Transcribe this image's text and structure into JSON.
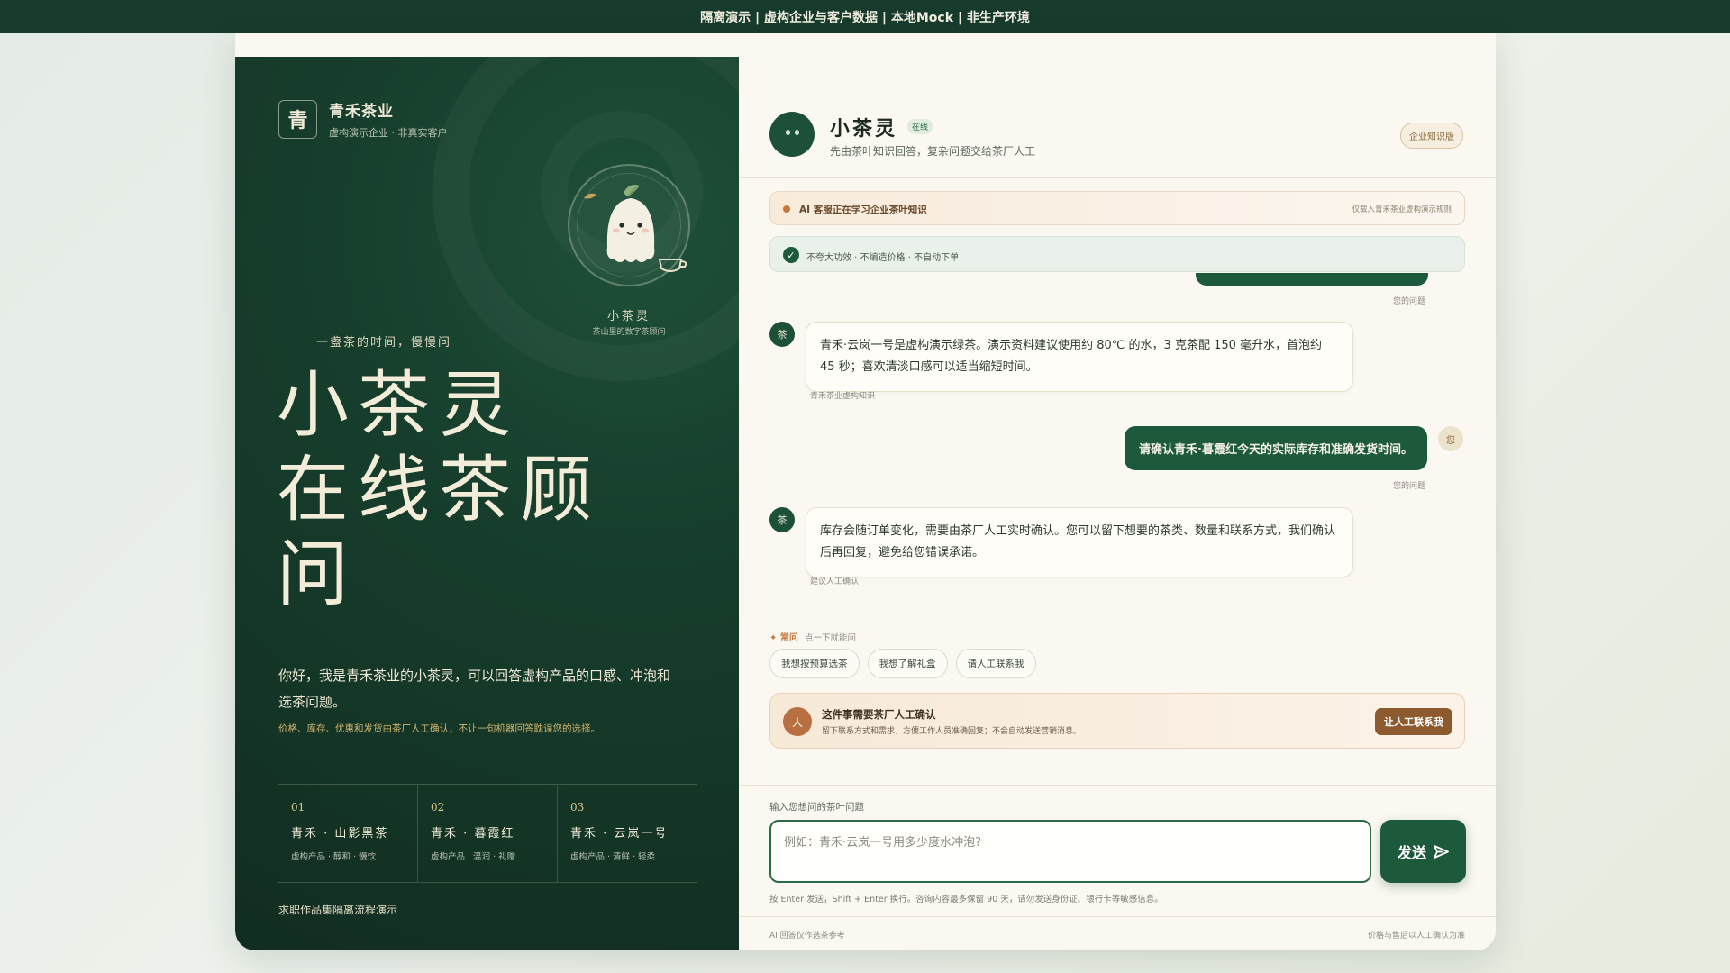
{
  "topbar": {
    "text": "隔离演示 | 虚构企业与客户数据 | 本地Mock | 非生产环境"
  },
  "left": {
    "brand_mark": "青",
    "brand_name": "青禾茶业",
    "brand_sub": "虚构演示企业 · 非真实客户",
    "mascot_name": "小茶灵",
    "mascot_sub": "茶山里的数字茶顾问",
    "tagline": "一盏茶的时间，慢慢问",
    "hero_line1": "小茶灵",
    "hero_line2": "在线茶顾问",
    "intro": "你好，我是青禾茶业的小茶灵，可以回答虚构产品的口感、冲泡和选茶问题。",
    "note": "价格、库存、优惠和发货由茶厂人工确认，不让一句机器回答耽误您的选择。",
    "products": [
      {
        "no": "01",
        "name": "青禾 · 山影黑茶",
        "desc": "虚构产品 · 醇和 · 慢饮"
      },
      {
        "no": "02",
        "name": "青禾 · 暮霞红",
        "desc": "虚构产品 · 温润 · 礼赠"
      },
      {
        "no": "03",
        "name": "青禾 · 云岚一号",
        "desc": "虚构产品 · 清鲜 · 轻柔"
      }
    ],
    "footer": "求职作品集隔离流程演示"
  },
  "header": {
    "avatar": "",
    "name": "小茶灵",
    "status": "在线",
    "sub": "先由茶叶知识回答，复杂问题交给茶厂人工",
    "kb_button": "企业知识版"
  },
  "learn_banner": {
    "text": "AI 客服正在学习企业茶叶知识",
    "right": "仅载入青禾茶业虚构演示规则"
  },
  "rules_banner": {
    "text": "不夸大功效 · 不编造价格 · 不自动下单"
  },
  "messages": [
    {
      "role": "user_meta",
      "meta": "您的问题"
    },
    {
      "role": "bot",
      "avatar": "茶",
      "text": "青禾·云岚一号是虚构演示绿茶。演示资料建议使用约 80℃ 的水，3 克茶配 150 毫升水，首泡约 45 秒；喜欢清淡口感可以适当缩短时间。",
      "meta": "青禾茶业虚构知识"
    },
    {
      "role": "user",
      "avatar": "您",
      "text": "请确认青禾·暮霞红今天的实际库存和准确发货时间。",
      "meta": "您的问题"
    },
    {
      "role": "bot",
      "avatar": "茶",
      "text": "库存会随订单变化，需要由茶厂人工实时确认。您可以留下想要的茶类、数量和联系方式，我们确认后再回复，避免给您错误承诺。",
      "meta": "建议人工确认"
    }
  ],
  "quick": {
    "label": "常问",
    "hint": "点一下就能问",
    "chips": [
      "我想按预算选茶",
      "我想了解礼盒",
      "请人工联系我"
    ]
  },
  "handoff": {
    "icon": "人",
    "title": "这件事需要茶厂人工确认",
    "desc": "留下联系方式和需求，方便工作人员准确回复；不会自动发送营销消息。",
    "button": "让人工联系我"
  },
  "composer": {
    "label": "输入您想问的茶叶问题",
    "placeholder": "例如：青禾·云岚一号用多少度水冲泡?",
    "value": "",
    "send": "发送",
    "tip": "按 Enter 发送，Shift + Enter 换行。咨询内容最多保留 90 天，请勿发送身份证、银行卡等敏感信息。"
  },
  "footer": {
    "left": "AI 回答仅作选茶参考",
    "right": "价格与售后以人工确认为准"
  },
  "colors": {
    "brand_green": "#1c5a3b",
    "dark_panel": "#143526",
    "accent_brown": "#8c5a2e",
    "accent_orange": "#c4783d"
  }
}
